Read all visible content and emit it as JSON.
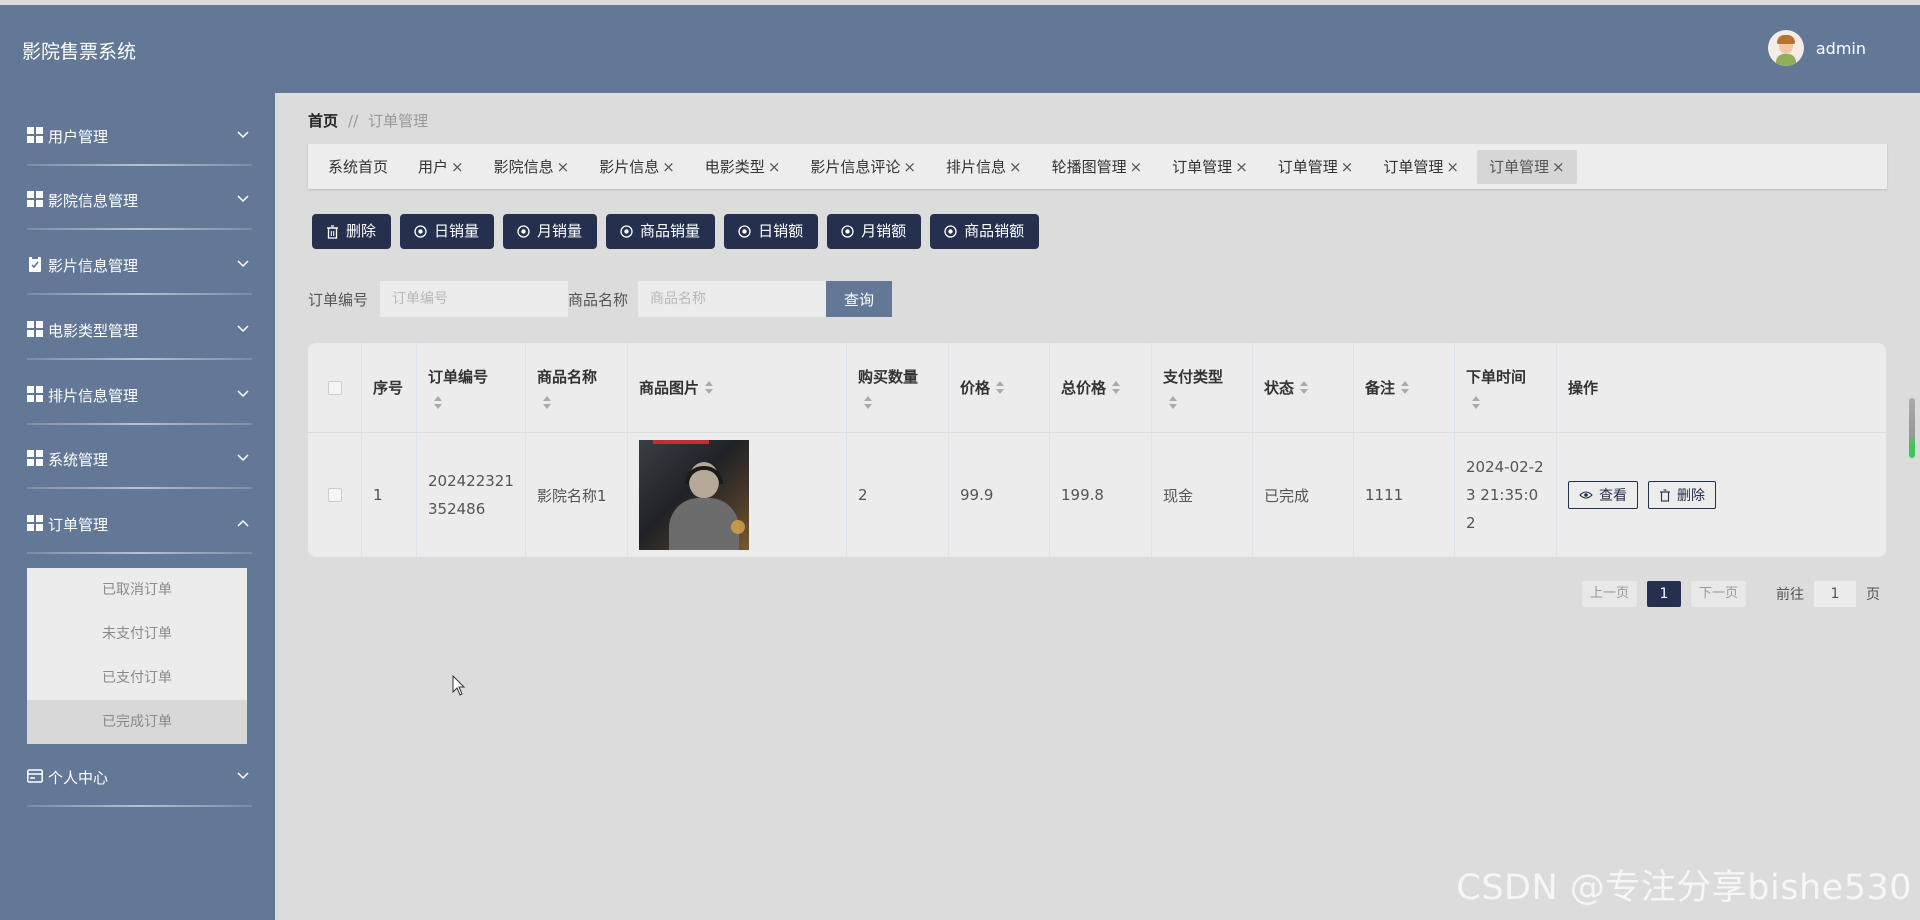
{
  "app": {
    "title": "影院售票系统",
    "user_name": "admin"
  },
  "sidebar": {
    "items": [
      {
        "label": "用户管理",
        "icon": "grid-icon",
        "expanded": false
      },
      {
        "label": "影院信息管理",
        "icon": "grid-icon",
        "expanded": false
      },
      {
        "label": "影片信息管理",
        "icon": "clipboard-icon",
        "expanded": false
      },
      {
        "label": "电影类型管理",
        "icon": "grid-icon",
        "expanded": false
      },
      {
        "label": "排片信息管理",
        "icon": "grid-icon",
        "expanded": false
      },
      {
        "label": "系统管理",
        "icon": "grid-icon",
        "expanded": false
      },
      {
        "label": "订单管理",
        "icon": "grid-icon",
        "expanded": true
      },
      {
        "label": "个人中心",
        "icon": "card-icon",
        "expanded": false
      }
    ],
    "submenu": [
      {
        "label": "已取消订单"
      },
      {
        "label": "未支付订单"
      },
      {
        "label": "已支付订单"
      },
      {
        "label": "已完成订单",
        "active": true
      }
    ]
  },
  "breadcrumb": {
    "home": "首页",
    "separator": "//",
    "current": "订单管理"
  },
  "tabs": [
    {
      "label": "系统首页",
      "closable": false
    },
    {
      "label": "用户",
      "closable": true
    },
    {
      "label": "影院信息",
      "closable": true
    },
    {
      "label": "影片信息",
      "closable": true
    },
    {
      "label": "电影类型",
      "closable": true
    },
    {
      "label": "影片信息评论",
      "closable": true
    },
    {
      "label": "排片信息",
      "closable": true
    },
    {
      "label": "轮播图管理",
      "closable": true
    },
    {
      "label": "订单管理",
      "closable": true
    },
    {
      "label": "订单管理",
      "closable": true
    },
    {
      "label": "订单管理",
      "closable": true
    },
    {
      "label": "订单管理",
      "closable": true,
      "active": true
    }
  ],
  "actions": [
    {
      "label": "删除",
      "icon": "trash-icon"
    },
    {
      "label": "日销量",
      "icon": "chart-icon"
    },
    {
      "label": "月销量",
      "icon": "chart-icon"
    },
    {
      "label": "商品销量",
      "icon": "chart-icon"
    },
    {
      "label": "日销额",
      "icon": "chart-icon"
    },
    {
      "label": "月销额",
      "icon": "chart-icon"
    },
    {
      "label": "商品销额",
      "icon": "chart-icon"
    }
  ],
  "search": {
    "order_no_label": "订单编号",
    "order_no_placeholder": "订单编号",
    "product_name_label": "商品名称",
    "product_name_placeholder": "商品名称",
    "query_label": "查询"
  },
  "table": {
    "headers": {
      "index": "序号",
      "order_no": "订单编号",
      "product_name": "商品名称",
      "product_image": "商品图片",
      "quantity": "购买数量",
      "price": "价格",
      "total": "总价格",
      "pay_type": "支付类型",
      "status": "状态",
      "remark": "备注",
      "order_time": "下单时间",
      "ops": "操作"
    },
    "rows": [
      {
        "index": "1",
        "order_no": "202422321352486",
        "product_name": "影院名称1",
        "quantity": "2",
        "price": "99.9",
        "total": "199.8",
        "pay_type": "现金",
        "status": "已完成",
        "remark": "1111",
        "order_time": "2024-02-23 21:35:02",
        "view_label": "查看",
        "delete_label": "删除"
      }
    ]
  },
  "pagination": {
    "prev": "上一页",
    "current": "1",
    "next": "下一页",
    "goto_prefix": "前往",
    "goto_value": "1",
    "goto_suffix": "页"
  },
  "watermark": "CSDN @专注分享bishe530",
  "colors": {
    "header_bg": "#637896",
    "primary_button": "#24304d",
    "content_bg": "#dcdcdc"
  }
}
